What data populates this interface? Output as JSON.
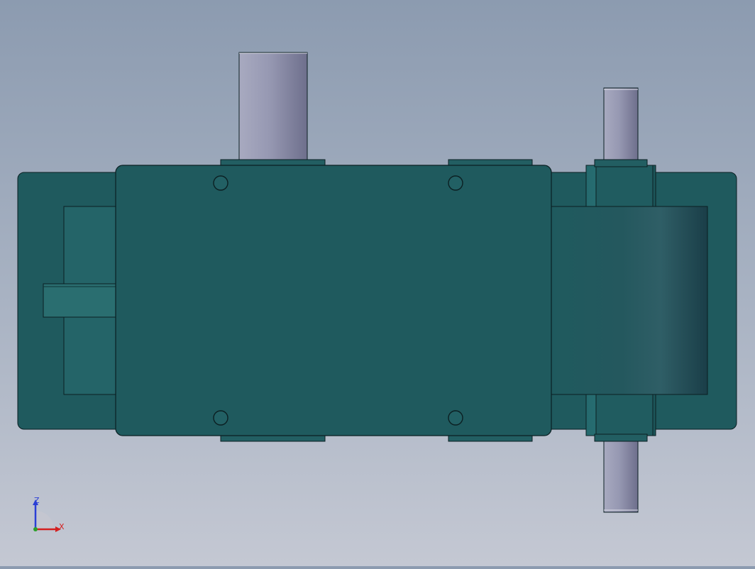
{
  "viewport": {
    "background_top": "#8c9bb0",
    "background_bottom": "#c4c8d3"
  },
  "model": {
    "body_color": "#1f5a5e",
    "face_color": "#1f5a5e",
    "recess_color": "#246468",
    "shaft_color": "#8e90a8",
    "outline_color": "#0b1f22"
  },
  "triad": {
    "z_label": "Z",
    "x_label": "X",
    "z_color": "#2b3fd6",
    "x_color": "#d42020",
    "y_color": "#2aa02a"
  }
}
